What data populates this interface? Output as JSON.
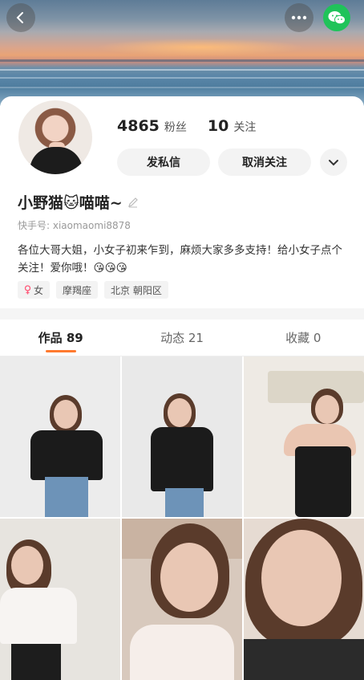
{
  "profile": {
    "fans_count": "4865",
    "fans_label": "粉丝",
    "following_count": "10",
    "following_label": "关注",
    "message_button": "发私信",
    "unfollow_button": "取消关注",
    "name": "小野猫🐱喵喵~",
    "user_id": "快手号: xiaomaomi8878",
    "bio": "各位大哥大姐，小女子初来乍到，麻烦大家多多支持！给小女子点个关注！爱你哦！😘😘😘",
    "tags": [
      "女",
      "摩羯座",
      "北京 朝阳区"
    ]
  },
  "tabs": [
    {
      "label": "作品 89"
    },
    {
      "label": "动态 21"
    },
    {
      "label": "收藏 0"
    }
  ],
  "colors": {
    "accent": "#ff7a2f",
    "wechat": "#1fc35a",
    "button_bg": "#f3f3f3"
  },
  "icons": {
    "back": "chevron-left-icon",
    "more": "more-dots-icon",
    "share": "wechat-icon",
    "expand": "chevron-down-icon",
    "edit": "pencil-icon",
    "gender": "female-icon"
  }
}
